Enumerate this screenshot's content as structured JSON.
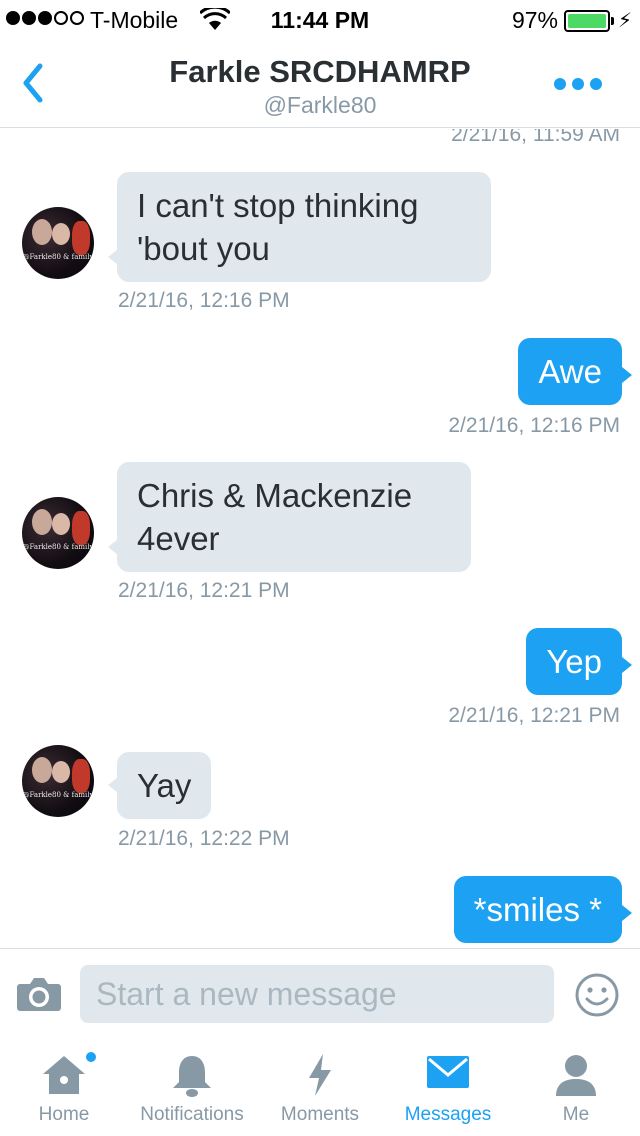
{
  "status_bar": {
    "carrier": "T-Mobile",
    "time": "11:44 PM",
    "battery": "97%",
    "signal_bars": 3,
    "signal_total": 5,
    "battery_level": 0.97
  },
  "header": {
    "title": "Farkle SRCDHAMRP",
    "handle": "@Farkle80"
  },
  "avatar_caption": "@Farkle80 & family",
  "messages": [
    {
      "type": "timestamp",
      "text": "2/21/16, 11:59 AM"
    },
    {
      "type": "incoming",
      "text": "I can't stop thinking 'bout you",
      "time": "2/21/16, 12:16 PM"
    },
    {
      "type": "outgoing",
      "text": "Awe",
      "time": "2/21/16, 12:16 PM"
    },
    {
      "type": "incoming",
      "text": "Chris & Mackenzie 4ever",
      "time": "2/21/16, 12:21 PM"
    },
    {
      "type": "outgoing",
      "text": "Yep",
      "time": "2/21/16, 12:21 PM"
    },
    {
      "type": "incoming",
      "text": "Yay",
      "time": "2/21/16, 12:22 PM"
    },
    {
      "type": "outgoing",
      "text": "*smiles *"
    }
  ],
  "composer": {
    "placeholder": "Start a new message"
  },
  "tabs": [
    {
      "label": "Home",
      "icon": "home-icon",
      "has_badge": true
    },
    {
      "label": "Notifications",
      "icon": "bell-icon"
    },
    {
      "label": "Moments",
      "icon": "lightning-icon"
    },
    {
      "label": "Messages",
      "icon": "envelope-icon",
      "active": true
    },
    {
      "label": "Me",
      "icon": "person-icon"
    }
  ],
  "colors": {
    "accent": "#1da1f2",
    "incoming_bubble": "#e1e8ed",
    "muted_text": "#8899a6",
    "battery_green": "#4cd964"
  }
}
